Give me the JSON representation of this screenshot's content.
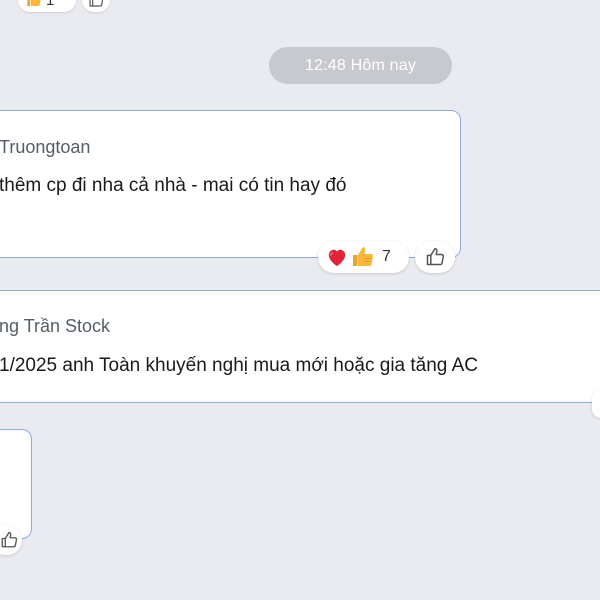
{
  "top_reactions": {
    "count": "1"
  },
  "timestamp": {
    "label": "12:48 Hôm nay"
  },
  "messages": [
    {
      "sender": "Truongtoan",
      "text": "thêm cp đi nha cả nhà - mai có tin hay đó",
      "reactions": {
        "count": "7"
      }
    },
    {
      "sender": "ng Trần Stock",
      "text": "1/2025 anh Toàn khuyến nghị mua mới hoặc  gia tăng AC"
    }
  ],
  "icons": {
    "heart": "heart-icon",
    "thumbs_up_emoji": "thumbs-up-emoji-icon",
    "like_outline": "like-outline-icon"
  },
  "colors": {
    "background": "#e9ebf0",
    "bubble_border": "#8fa8de",
    "timestamp_bg": "#c7c9ce",
    "heart": "#e0243a",
    "thumbs_up": "#f6b73c"
  }
}
